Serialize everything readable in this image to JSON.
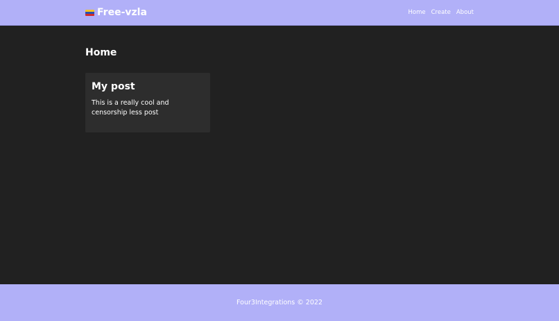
{
  "header": {
    "brand_label": "Free-vzla",
    "brand_icon": "venezuela-flag",
    "nav": {
      "home_label": "Home",
      "create_label": "Create",
      "about_label": "About"
    }
  },
  "main": {
    "page_title": "Home",
    "posts": [
      {
        "title": "My post",
        "body": "This is a really cool and censorship less post"
      }
    ]
  },
  "footer": {
    "text": "Four3Integrations © 2022"
  },
  "colors": {
    "accent": "#b1b0f8",
    "background": "#212121",
    "card": "#2d2d2d",
    "text": "#ffffff"
  }
}
